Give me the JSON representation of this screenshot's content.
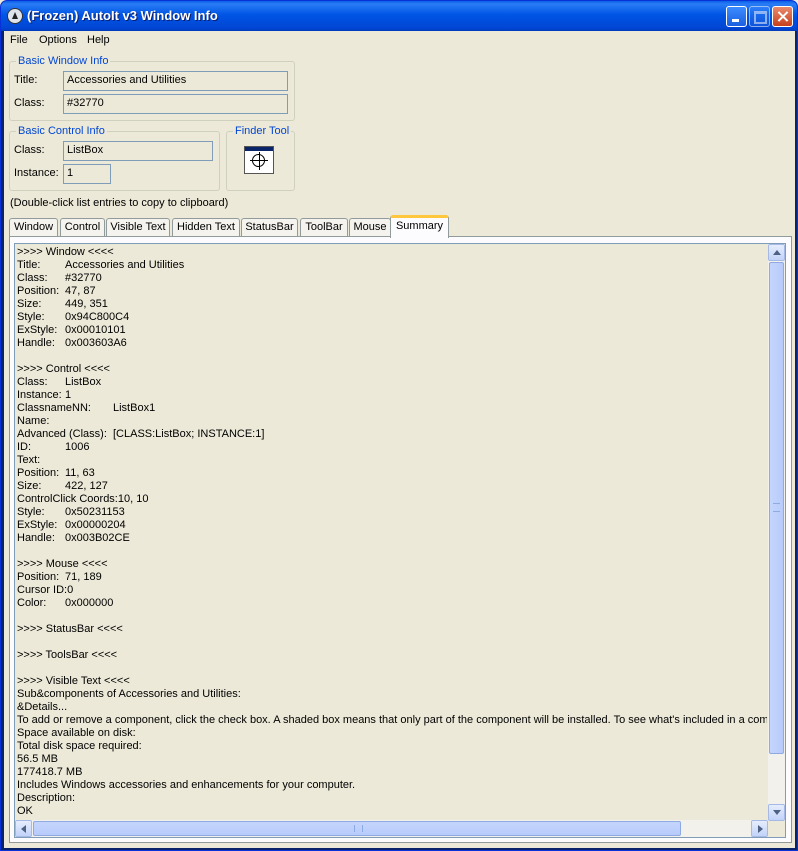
{
  "window": {
    "title": "(Frozen) AutoIt v3 Window Info",
    "accent": "#0055e5"
  },
  "menu": {
    "items": [
      "File",
      "Options",
      "Help"
    ]
  },
  "basic_window_info": {
    "legend": "Basic Window Info",
    "title_label": "Title:",
    "title_value": "Accessories and Utilities",
    "class_label": "Class:",
    "class_value": "#32770"
  },
  "basic_control_info": {
    "legend": "Basic Control Info",
    "class_label": "Class:",
    "class_value": "ListBox",
    "instance_label": "Instance:",
    "instance_value": "1"
  },
  "finder_tool": {
    "legend": "Finder Tool",
    "icon": "crosshair-icon"
  },
  "hint": "(Double-click list entries to copy to clipboard)",
  "tabs": [
    "Window",
    "Control",
    "Visible Text",
    "Hidden Text",
    "StatusBar",
    "ToolBar",
    "Mouse",
    "Summary"
  ],
  "active_tab": "Summary",
  "summary_lines": [
    ">>>> Window <<<<",
    "Title:\tAccessories and Utilities",
    "Class:\t#32770",
    "Position:\t47, 87",
    "Size:\t449, 351",
    "Style:\t0x94C800C4",
    "ExStyle:\t0x00010101",
    "Handle:\t0x003603A6",
    "",
    ">>>> Control <<<<",
    "Class:\tListBox",
    "Instance:\t1",
    "ClassnameNN:\tListBox1",
    "Name:",
    "Advanced (Class):\t[CLASS:ListBox; INSTANCE:1]",
    "ID:\t1006",
    "Text:",
    "Position:\t11, 63",
    "Size:\t422, 127",
    "ControlClick Coords:\t10, 10",
    "Style:\t0x50231153",
    "ExStyle:\t0x00000204",
    "Handle:\t0x003B02CE",
    "",
    ">>>> Mouse <<<<",
    "Position:\t71, 189",
    "Cursor ID:\t0",
    "Color:\t0x000000",
    "",
    ">>>> StatusBar <<<<",
    "",
    ">>>> ToolsBar <<<<",
    "",
    ">>>> Visible Text <<<<",
    "Sub&components of Accessories and Utilities:",
    "&Details...",
    "To add or remove a component, click the check box. A shaded box means that only part of the component will be installed. To see what's included in a compon",
    "Space available on disk:",
    "Total disk space required:",
    "56.5 MB",
    "177418.7 MB",
    "Includes Windows accessories and enhancements for your computer.",
    "Description:",
    "OK"
  ]
}
